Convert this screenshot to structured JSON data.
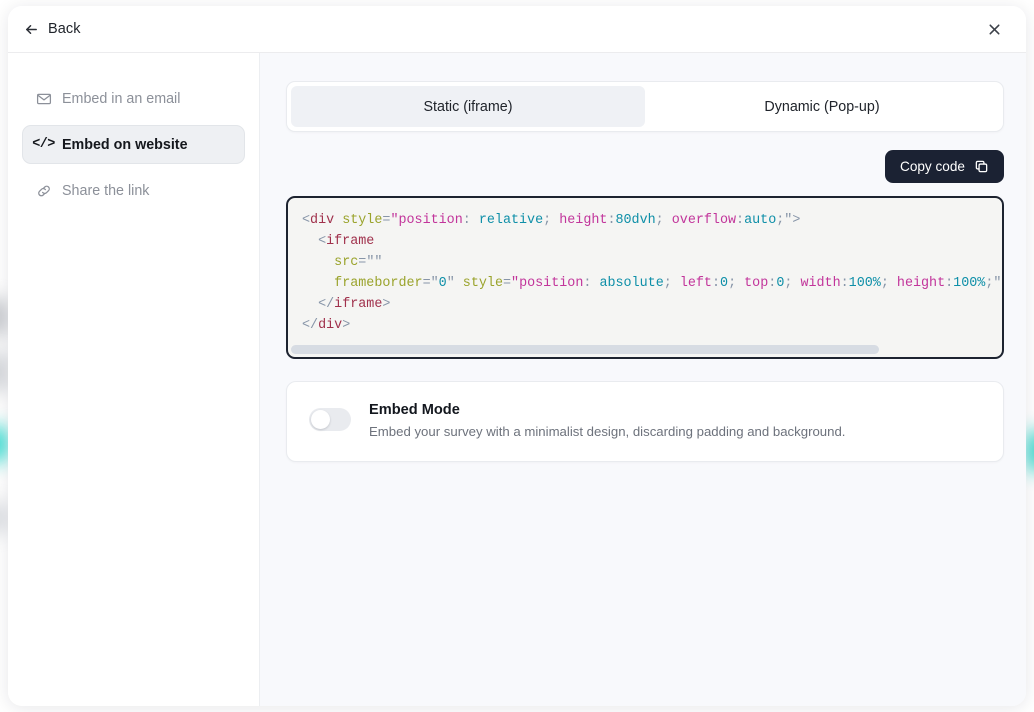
{
  "header": {
    "back_label": "Back",
    "back_icon": "arrow-left-icon",
    "close_icon": "close-icon"
  },
  "sidebar": {
    "items": [
      {
        "id": "email",
        "label": "Embed in an email",
        "icon": "envelope-icon",
        "active": false
      },
      {
        "id": "website",
        "label": "Embed on website",
        "icon": "code-icon",
        "active": true
      },
      {
        "id": "link",
        "label": "Share the link",
        "icon": "link-icon",
        "active": false
      }
    ]
  },
  "main": {
    "tabs": [
      {
        "id": "static",
        "label": "Static (iframe)",
        "active": true
      },
      {
        "id": "dynamic",
        "label": "Dynamic (Pop-up)",
        "active": false
      }
    ],
    "copy_button": {
      "label": "Copy code",
      "icon": "copy-icon"
    },
    "code": {
      "language": "html",
      "scroll_thumb_percent": 83,
      "text": "<div style=\"position: relative; height:80dvh; overflow:auto;\">\n  <iframe\n    src=\"\"\n    frameborder=\"0\" style=\"position: absolute; left:0; top:0; width:100%; height:100%;\"\n  </iframe>\n</div>",
      "lines": [
        [
          {
            "t": "<",
            "c": "punc"
          },
          {
            "t": "div",
            "c": "tag"
          },
          {
            "t": " ",
            "c": "punc"
          },
          {
            "t": "style",
            "c": "attr"
          },
          {
            "t": "=",
            "c": "punc"
          },
          {
            "t": "\"position",
            "c": "prop"
          },
          {
            "t": ":",
            "c": "punc"
          },
          {
            "t": " relative",
            "c": "val"
          },
          {
            "t": ";",
            "c": "semi"
          },
          {
            "t": " height",
            "c": "prop"
          },
          {
            "t": ":",
            "c": "punc"
          },
          {
            "t": "80dvh",
            "c": "val"
          },
          {
            "t": ";",
            "c": "semi"
          },
          {
            "t": " overflow",
            "c": "prop"
          },
          {
            "t": ":",
            "c": "punc"
          },
          {
            "t": "auto",
            "c": "val"
          },
          {
            "t": ";",
            "c": "semi"
          },
          {
            "t": "\">",
            "c": "punc"
          }
        ],
        [
          {
            "t": "  <",
            "c": "punc"
          },
          {
            "t": "iframe",
            "c": "tag"
          }
        ],
        [
          {
            "t": "    ",
            "c": "punc"
          },
          {
            "t": "src",
            "c": "attr"
          },
          {
            "t": "=",
            "c": "punc"
          },
          {
            "t": "\"\"",
            "c": "punc"
          }
        ],
        [
          {
            "t": "    ",
            "c": "punc"
          },
          {
            "t": "frameborder",
            "c": "attr"
          },
          {
            "t": "=",
            "c": "punc"
          },
          {
            "t": "\"",
            "c": "punc"
          },
          {
            "t": "0",
            "c": "num"
          },
          {
            "t": "\"",
            "c": "punc"
          },
          {
            "t": " ",
            "c": "punc"
          },
          {
            "t": "style",
            "c": "attr"
          },
          {
            "t": "=",
            "c": "punc"
          },
          {
            "t": "\"position",
            "c": "prop"
          },
          {
            "t": ":",
            "c": "punc"
          },
          {
            "t": " absolute",
            "c": "val"
          },
          {
            "t": ";",
            "c": "semi"
          },
          {
            "t": " left",
            "c": "prop"
          },
          {
            "t": ":",
            "c": "punc"
          },
          {
            "t": "0",
            "c": "val"
          },
          {
            "t": ";",
            "c": "semi"
          },
          {
            "t": " top",
            "c": "prop"
          },
          {
            "t": ":",
            "c": "punc"
          },
          {
            "t": "0",
            "c": "val"
          },
          {
            "t": ";",
            "c": "semi"
          },
          {
            "t": " width",
            "c": "prop"
          },
          {
            "t": ":",
            "c": "punc"
          },
          {
            "t": "100%",
            "c": "val"
          },
          {
            "t": ";",
            "c": "semi"
          },
          {
            "t": " height",
            "c": "prop"
          },
          {
            "t": ":",
            "c": "punc"
          },
          {
            "t": "100%",
            "c": "val"
          },
          {
            "t": ";",
            "c": "semi"
          },
          {
            "t": "\"",
            "c": "punc"
          }
        ],
        [
          {
            "t": "  </",
            "c": "punc"
          },
          {
            "t": "iframe",
            "c": "tag"
          },
          {
            "t": ">",
            "c": "punc"
          }
        ],
        [
          {
            "t": "</",
            "c": "punc"
          },
          {
            "t": "div",
            "c": "tag"
          },
          {
            "t": ">",
            "c": "punc"
          }
        ]
      ]
    },
    "embed_mode": {
      "enabled": false,
      "title": "Embed Mode",
      "description": "Embed your survey with a minimalist design, discarding padding and background."
    }
  },
  "colors": {
    "page_background": "#ffffff",
    "main_background": "#f8f9fc",
    "code_background": "#f5f5f3",
    "code_border": "#1d2330",
    "copy_button": "#1b2233",
    "active_nav": "#eef0f3",
    "accent_teal": "#0ad6c8"
  }
}
